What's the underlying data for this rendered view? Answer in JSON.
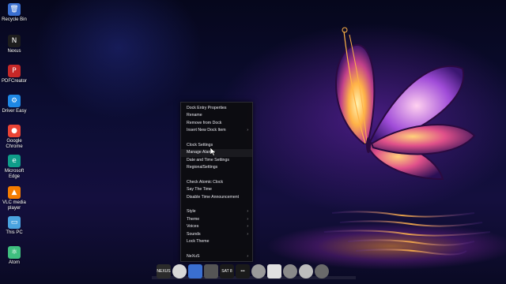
{
  "desktop_icons": [
    {
      "label": "Recycle Bin",
      "icon": "recycle-bin-icon",
      "color": "#3a6fd0"
    },
    {
      "label": "Nexus",
      "icon": "nexus-icon",
      "color": "#1d1d1d"
    },
    {
      "label": "PDFCreator",
      "icon": "pdfcreator-icon",
      "color": "#c62828"
    },
    {
      "label": "Driver Easy",
      "icon": "driver-easy-icon",
      "color": "#1e88e5"
    },
    {
      "label": "Google Chrome",
      "icon": "chrome-icon",
      "color": "#ea4335"
    },
    {
      "label": "Microsoft Edge",
      "icon": "edge-icon",
      "color": "#0f9d8a"
    },
    {
      "label": "VLC media player",
      "icon": "vlc-icon",
      "color": "#f57c00"
    },
    {
      "label": "This PC",
      "icon": "this-pc-icon",
      "color": "#4aa3df"
    },
    {
      "label": "Atom",
      "icon": "atom-icon",
      "color": "#3fbf7f"
    }
  ],
  "context_menu": {
    "groups": [
      [
        {
          "label": "Dock Entry Properties",
          "submenu": false
        },
        {
          "label": "Rename",
          "submenu": false
        },
        {
          "label": "Remove from Dock",
          "submenu": false
        },
        {
          "label": "Insert New Dock Item",
          "submenu": true
        }
      ],
      [
        {
          "label": "Clock Settings",
          "submenu": false
        },
        {
          "label": "Manage Alarms",
          "submenu": false
        },
        {
          "label": "Date and Time Settings",
          "submenu": false
        },
        {
          "label": "RegionalSettings",
          "submenu": false
        }
      ],
      [
        {
          "label": "Check Atomic Clock",
          "submenu": false
        },
        {
          "label": "Say The Time",
          "submenu": false
        },
        {
          "label": "Disable Time Announcement",
          "submenu": false
        }
      ],
      [
        {
          "label": "Style",
          "submenu": true
        },
        {
          "label": "Theme",
          "submenu": true
        },
        {
          "label": "Voices",
          "submenu": true
        },
        {
          "label": "Sounds",
          "submenu": true
        },
        {
          "label": "Lock Theme",
          "submenu": false
        }
      ],
      [
        {
          "label": "NeXuS",
          "submenu": true
        }
      ]
    ],
    "submenu_arrow": "›",
    "hovered": "Manage Alarms"
  },
  "dock": {
    "items": [
      {
        "name": "nexus-logo",
        "label": "NEXUS",
        "color": "#2b2b2b",
        "round": false
      },
      {
        "name": "clock",
        "label": "",
        "color": "#d8d8d8",
        "round": true
      },
      {
        "name": "recycle-bin",
        "label": "",
        "color": "#3a6fd0",
        "round": false
      },
      {
        "name": "document",
        "label": "",
        "color": "#555555",
        "round": false
      },
      {
        "name": "calendar",
        "label": "SAT 8",
        "color": "#1a1a1a",
        "round": false
      },
      {
        "name": "menu-dots",
        "label": "•••",
        "color": "#1a1a1a",
        "round": false
      },
      {
        "name": "disc",
        "label": "",
        "color": "#9a9a9a",
        "round": true
      },
      {
        "name": "mail",
        "label": "",
        "color": "#e0e0e0",
        "round": false
      },
      {
        "name": "globe",
        "label": "",
        "color": "#8a8a8a",
        "round": true
      },
      {
        "name": "settings",
        "label": "",
        "color": "#bdbdbd",
        "round": true
      },
      {
        "name": "camera",
        "label": "",
        "color": "#6a6a6a",
        "round": true
      }
    ]
  },
  "colors": {
    "menu_bg": "#0c0c10",
    "menu_text": "#e8e8ee",
    "accent_orange": "#ffb24a",
    "accent_purple": "#7b2fc9"
  }
}
